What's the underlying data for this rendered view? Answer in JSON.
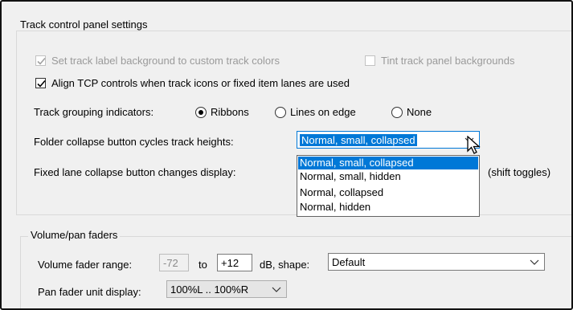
{
  "tcp": {
    "group_title": "Track control panel settings",
    "set_label_bg": {
      "label": "Set track label background to custom track colors",
      "checked": true,
      "disabled": true
    },
    "tint_bg": {
      "label": "Tint track panel backgrounds",
      "checked": false,
      "disabled": true
    },
    "align_tcp": {
      "label": "Align TCP controls when track icons or fixed item lanes are used",
      "checked": true
    },
    "grouping": {
      "label": "Track grouping indicators:",
      "options": [
        "Ribbons",
        "Lines on edge",
        "None"
      ],
      "selected": "Ribbons"
    },
    "folder_collapse": {
      "label": "Folder collapse button cycles track heights:",
      "value": "Normal, small, collapsed"
    },
    "fixed_lane": {
      "label": "Fixed lane collapse button changes display:",
      "suffix": "(shift toggles)"
    },
    "dropdown_options": [
      "Normal, small, collapsed",
      "Normal, small, hidden",
      "Normal, collapsed",
      "Normal, hidden"
    ],
    "dropdown_selected_index": 0
  },
  "volpan": {
    "group_title": "Volume/pan faders",
    "range_label": "Volume fader range:",
    "range_min": "-72",
    "to_label": "to",
    "range_max": "+12",
    "shape_label": "dB, shape:",
    "shape_value": "Default",
    "pan_label": "Pan fader unit display:",
    "pan_value": "100%L .. 100%R"
  },
  "colors": {
    "selection": "#0078d7",
    "dialog_bg": "#f0f0f0"
  }
}
